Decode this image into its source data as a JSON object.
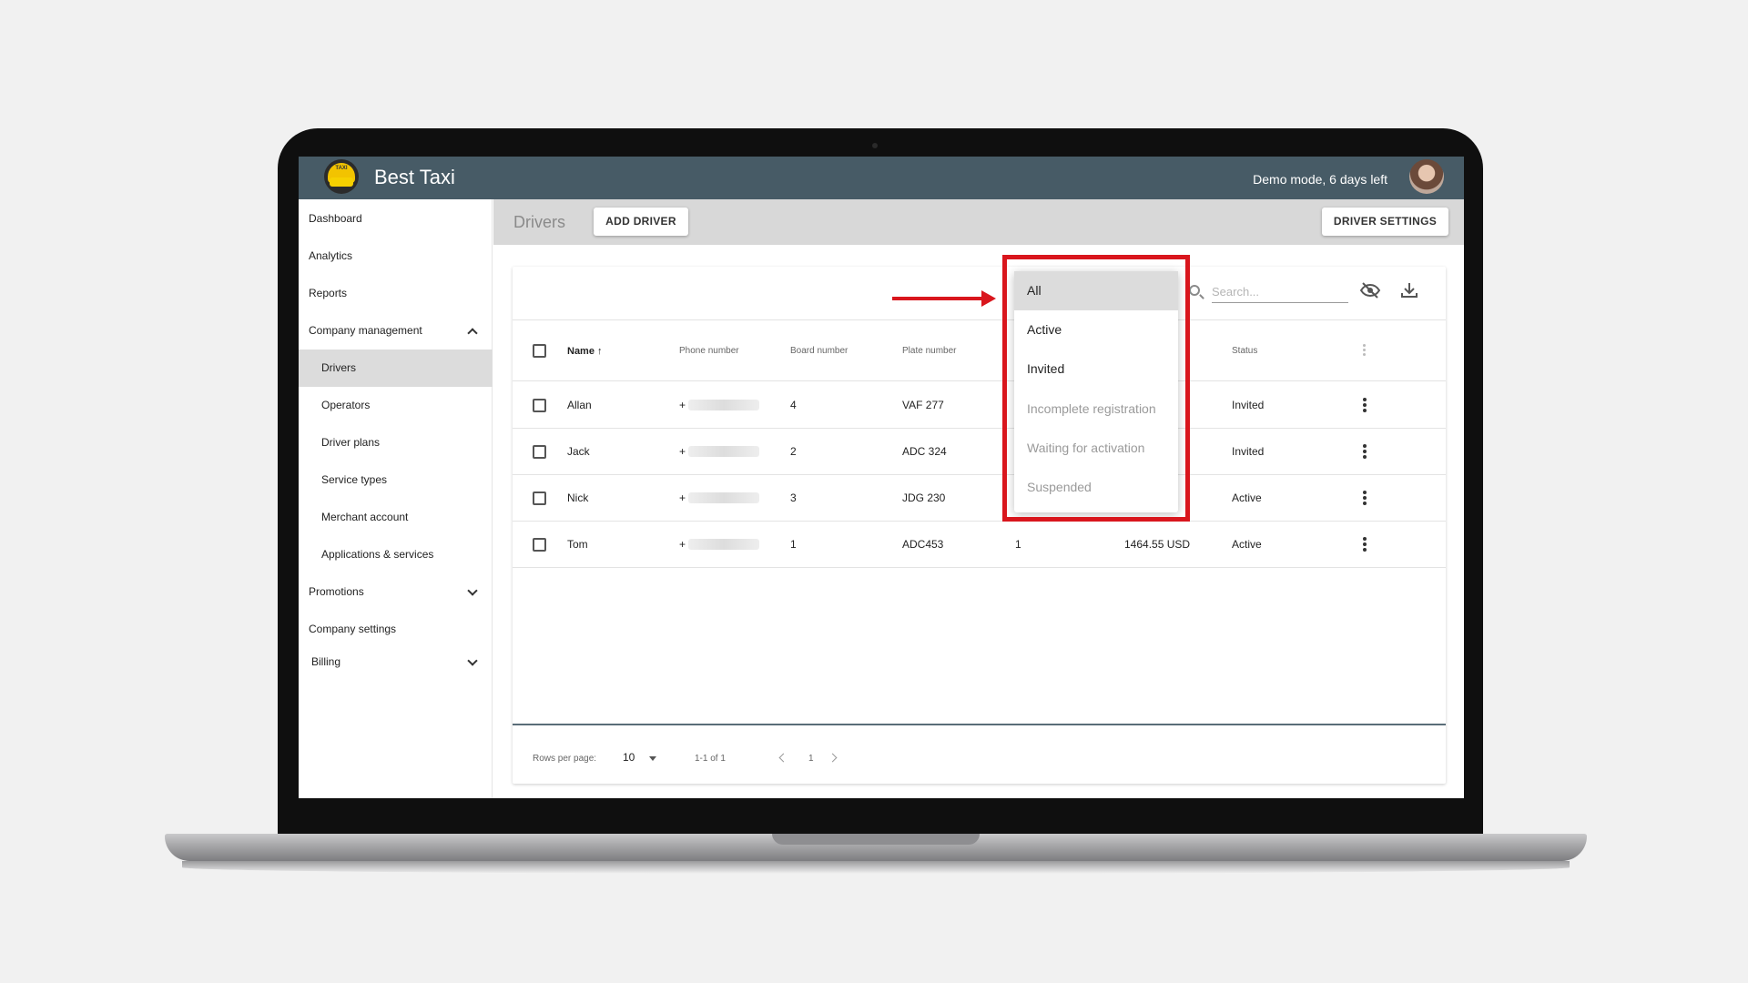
{
  "app": {
    "title": "Best Taxi",
    "demo_notice": "Demo mode, 6 days left",
    "logo_text": "TAXI"
  },
  "sidebar": {
    "items": [
      {
        "label": "Dashboard"
      },
      {
        "label": "Analytics"
      },
      {
        "label": "Reports"
      },
      {
        "label": "Company management"
      },
      {
        "label": "Drivers"
      },
      {
        "label": "Operators"
      },
      {
        "label": "Driver plans"
      },
      {
        "label": "Service types"
      },
      {
        "label": "Merchant account"
      },
      {
        "label": "Applications & services"
      },
      {
        "label": "Promotions"
      },
      {
        "label": "Company settings"
      },
      {
        "label": "Billing"
      }
    ]
  },
  "header": {
    "title": "Drivers",
    "add_button": "ADD DRIVER",
    "settings_button": "DRIVER SETTINGS"
  },
  "search": {
    "placeholder": "Search..."
  },
  "table": {
    "columns": {
      "name": "Name",
      "phone": "Phone number",
      "board": "Board number",
      "plate": "Plate number",
      "status": "Status"
    },
    "rows": [
      {
        "name": "Allan",
        "phone": "+",
        "board": "4",
        "plate": "VAF 277",
        "status": "Invited"
      },
      {
        "name": "Jack",
        "phone": "+",
        "board": "2",
        "plate": "ADC 324",
        "status": "Invited"
      },
      {
        "name": "Nick",
        "phone": "+",
        "board": "3",
        "plate": "JDG 230",
        "status": "Active"
      },
      {
        "name": "Tom",
        "phone": "+",
        "board": "1",
        "plate": "ADC453",
        "extra": "1",
        "balance": "1464.55 USD",
        "status": "Active"
      }
    ]
  },
  "footer": {
    "rows_per_page_label": "Rows per page:",
    "rows_per_page_value": "10",
    "range": "1-1 of 1",
    "page": "1"
  },
  "dropdown": {
    "options": [
      {
        "label": "All"
      },
      {
        "label": "Active"
      },
      {
        "label": "Invited"
      },
      {
        "label": "Incomplete registration"
      },
      {
        "label": "Waiting for activation"
      },
      {
        "label": "Suspended"
      }
    ]
  },
  "colors": {
    "topbar": "#475b66",
    "highlight": "#d9161d"
  }
}
